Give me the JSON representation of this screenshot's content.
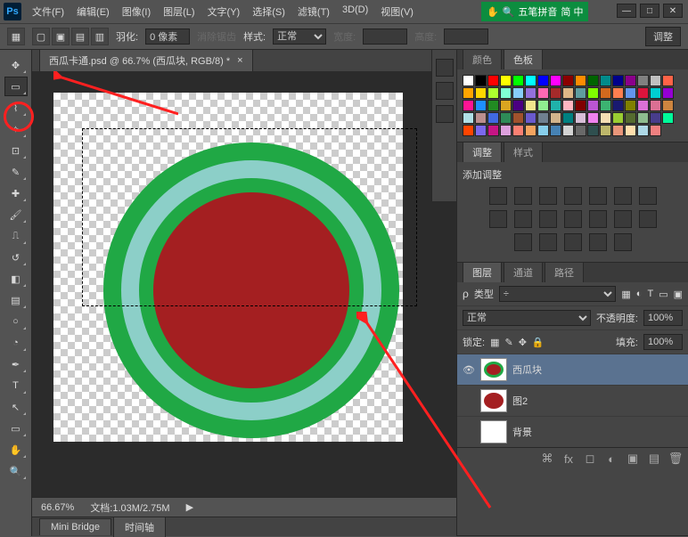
{
  "menu": [
    "文件(F)",
    "编辑(E)",
    "图像(I)",
    "图层(L)",
    "文字(Y)",
    "选择(S)",
    "滤镜(T)",
    "3D(D)",
    "视图(V)"
  ],
  "ime": {
    "label": "五笔拼音",
    "extra": "简 中",
    "icons": [
      "✋",
      "🔍"
    ]
  },
  "options": {
    "feather_label": "羽化:",
    "feather_value": "0 像素",
    "antialias": "消除锯齿",
    "style_label": "样式:",
    "style_value": "正常",
    "width_label": "宽度:",
    "height_label": "高度:",
    "adjust_btn": "调整"
  },
  "doc": {
    "tab": "西瓜卡通.psd @ 66.7% (西瓜块, RGB/8) *",
    "zoom": "66.67%",
    "status": "文档:1.03M/2.75M"
  },
  "bottom_tabs": [
    "Mini Bridge",
    "时间轴"
  ],
  "color_panel": {
    "tabs": [
      "颜色",
      "色板"
    ]
  },
  "swatches": [
    "#ffffff",
    "#000000",
    "#ff0000",
    "#ffff00",
    "#00ff00",
    "#00ffff",
    "#0000ff",
    "#ff00ff",
    "#8b0000",
    "#ff8c00",
    "#006400",
    "#008b8b",
    "#00008b",
    "#8b008b",
    "#808080",
    "#c0c0c0",
    "#ff6347",
    "#ffa500",
    "#ffd700",
    "#adff2f",
    "#7fffd4",
    "#87cefa",
    "#9370db",
    "#ff69b4",
    "#a52a2a",
    "#deb887",
    "#5f9ea0",
    "#7fff00",
    "#d2691e",
    "#ff7f50",
    "#6495ed",
    "#dc143c",
    "#00ced1",
    "#9400d3",
    "#ff1493",
    "#1e90ff",
    "#228b22",
    "#daa520",
    "#4b0082",
    "#f0e68c",
    "#90ee90",
    "#20b2aa",
    "#ffb6c1",
    "#800000",
    "#ba55d3",
    "#3cb371",
    "#191970",
    "#808000",
    "#da70d6",
    "#db7093",
    "#cd853f",
    "#b0e0e6",
    "#bc8f8f",
    "#4169e1",
    "#2e8b57",
    "#a0522d",
    "#6a5acd",
    "#708090",
    "#d2b48c",
    "#008080",
    "#d8bfd8",
    "#ee82ee",
    "#f5deb3",
    "#9acd32",
    "#556b2f",
    "#8fbc8f",
    "#483d8b",
    "#00fa9a",
    "#ff4500",
    "#7b68ee",
    "#c71585",
    "#dda0dd",
    "#fa8072",
    "#f4a460",
    "#87ceeb",
    "#4682b4",
    "#d3d3d3",
    "#696969",
    "#2f4f4f",
    "#bdb76b",
    "#e9967a",
    "#ffdead",
    "#add8e6",
    "#f08080"
  ],
  "adjustments": {
    "tabs": [
      "调整",
      "样式"
    ],
    "title": "添加调整"
  },
  "layers": {
    "tabs": [
      "图层",
      "通道",
      "路径"
    ],
    "kind_label": "类型",
    "blend_value": "正常",
    "opacity_label": "不透明度:",
    "opacity_value": "100%",
    "lock_label": "锁定:",
    "fill_label": "填充:",
    "fill_value": "100%",
    "items": [
      {
        "name": "西瓜块",
        "visible": true,
        "selected": true,
        "thumb_outer": "#20a845",
        "thumb_inner": "#a41f21"
      },
      {
        "name": "图2",
        "visible": false,
        "selected": false,
        "thumb_outer": "#a41f21",
        "thumb_inner": "#a41f21"
      },
      {
        "name": "背景",
        "visible": false,
        "selected": false,
        "thumb_outer": "#ffffff",
        "thumb_inner": "#ffffff"
      }
    ]
  },
  "tools": [
    "move",
    "marquee",
    "lasso",
    "wand",
    "crop",
    "eyedropper",
    "heal",
    "brush",
    "stamp",
    "history",
    "eraser",
    "gradient",
    "blur",
    "dodge",
    "pen",
    "type",
    "path",
    "rect",
    "hand",
    "zoom"
  ]
}
